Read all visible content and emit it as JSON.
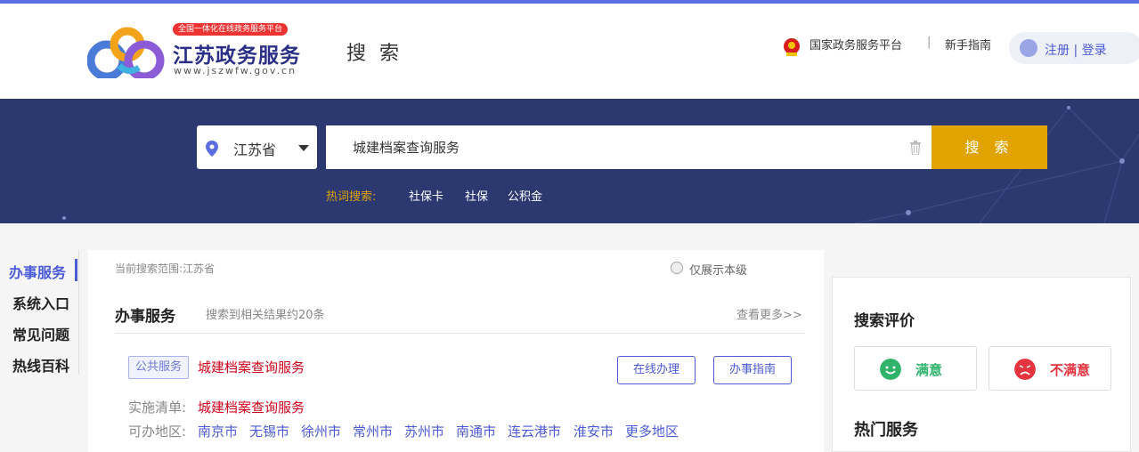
{
  "header": {
    "logo_badge": "全国一体化在线政务服务平台",
    "logo_name": "江苏政务服务",
    "logo_url": "www.jszwfw.gov.cn",
    "page_title": "搜 索",
    "national_platform": "国家政务服务平台",
    "separator": "|",
    "guide": "新手指南",
    "register": "注册",
    "login_sep": "|",
    "login": "登录"
  },
  "search": {
    "region": "江苏省",
    "query": "城建档案查询服务",
    "button": "搜 索",
    "hot_label": "热词搜索:",
    "hot_items": [
      "社保卡",
      "社保",
      "公积金"
    ]
  },
  "sidebar": {
    "items": [
      {
        "label": "办事服务"
      },
      {
        "label": "系统入口"
      },
      {
        "label": "常见问题"
      },
      {
        "label": "热线百科"
      }
    ]
  },
  "results": {
    "scope": "当前搜索范围:江苏省",
    "only_this_level": "仅展示本级",
    "section_title": "办事服务",
    "count_text": "搜索到相关结果约20条",
    "more": "查看更多>>",
    "item": {
      "tag": "公共服务",
      "title": "城建档案查询服务",
      "btn_online": "在线办理",
      "btn_guide": "办事指南",
      "impl_label": "实施清单:",
      "impl_value": "城建档案查询服务",
      "area_label": "可办地区:",
      "cities": [
        "南京市",
        "无锡市",
        "徐州市",
        "常州市",
        "苏州市",
        "南通市",
        "连云港市",
        "淮安市",
        "更多地区"
      ]
    }
  },
  "rating": {
    "title": "搜索评价",
    "satisfied": "满意",
    "unsatisfied": "不满意",
    "hot_title": "热门服务"
  },
  "colors": {
    "accent": "#4b5bd6",
    "banner": "#2c3870",
    "search_button": "#e0a300",
    "link_red": "#d0021b",
    "satisfied": "#2fb36b",
    "unsatisfied": "#e4343f"
  }
}
